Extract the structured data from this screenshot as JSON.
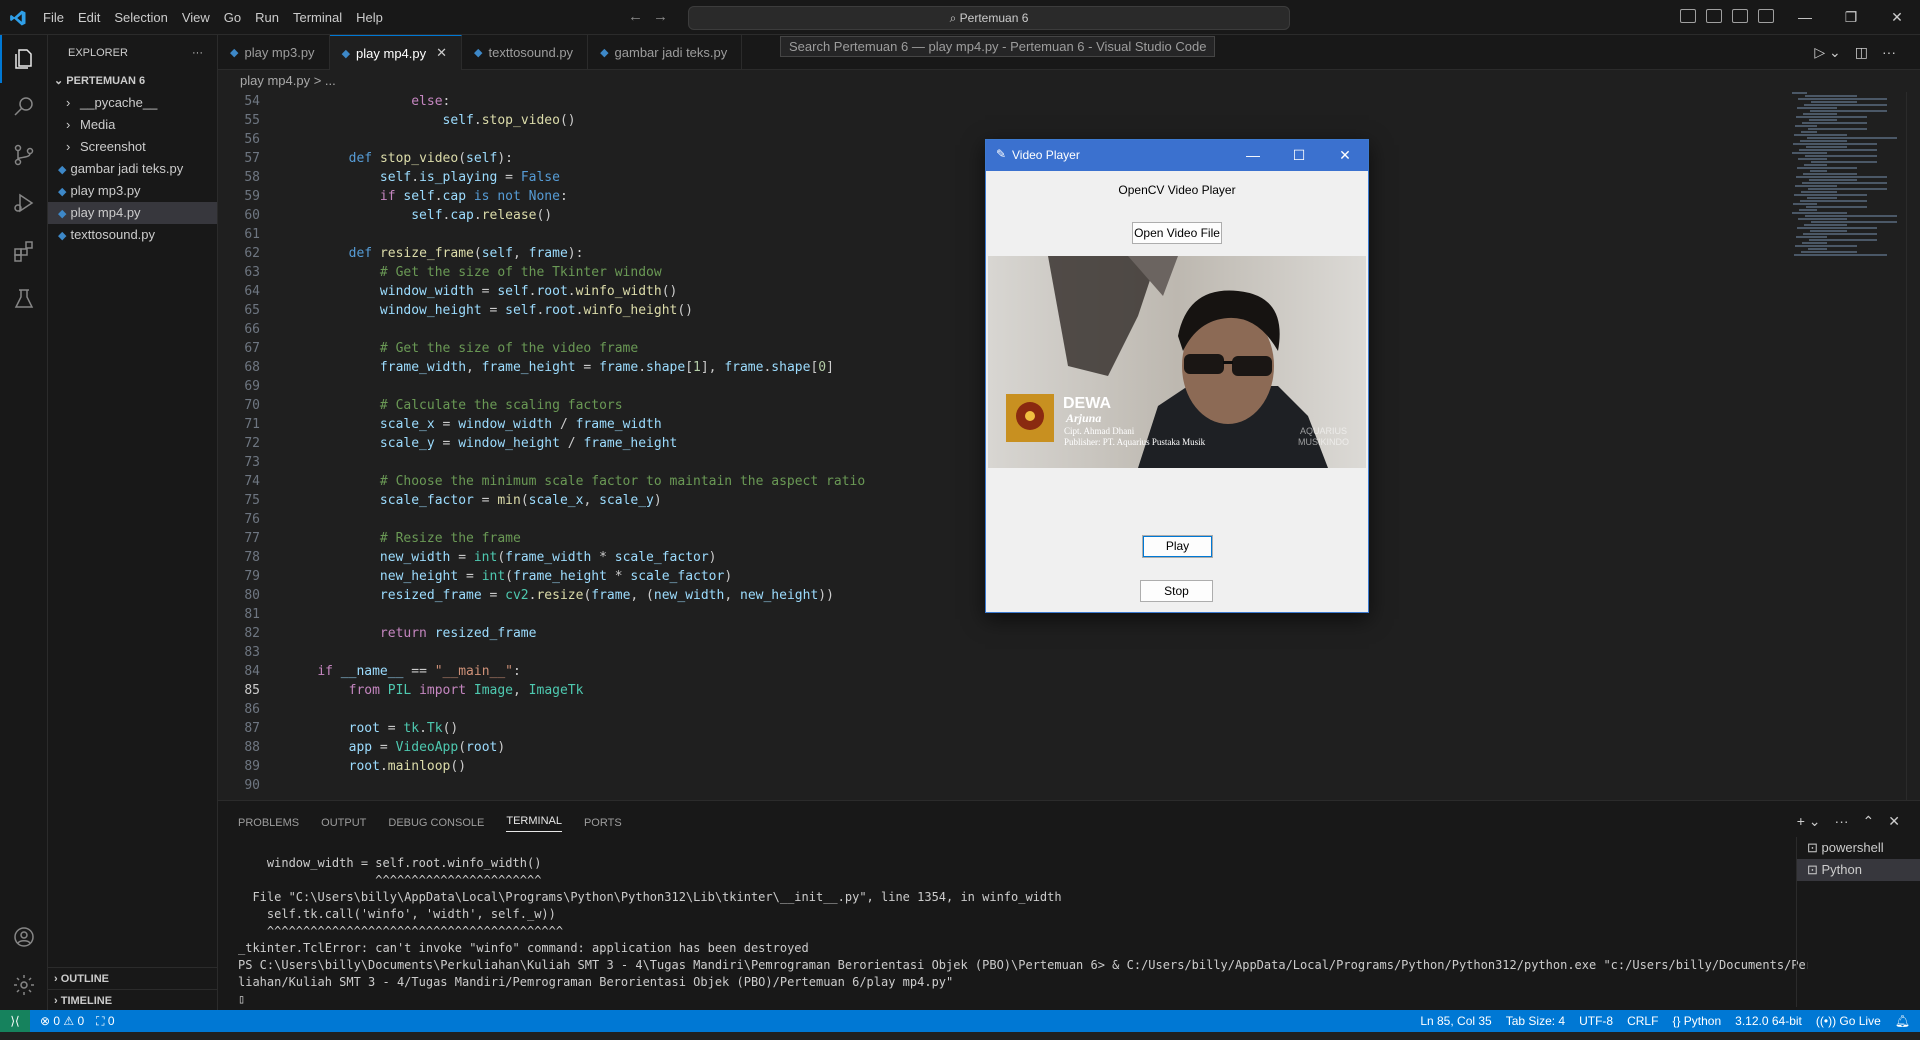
{
  "menu": [
    "File",
    "Edit",
    "Selection",
    "View",
    "Go",
    "Run",
    "Terminal",
    "Help"
  ],
  "command_center": "Pertemuan 6",
  "window_tooltip": "Search Pertemuan 6 — play mp4.py - Pertemuan 6 - Visual Studio Code",
  "explorer": {
    "title": "EXPLORER",
    "more": "···",
    "root": "PERTEMUAN 6",
    "items": [
      {
        "label": "__pycache__",
        "type": "folder"
      },
      {
        "label": "Media",
        "type": "folder"
      },
      {
        "label": "Screenshot",
        "type": "folder"
      },
      {
        "label": "gambar jadi teks.py",
        "type": "file"
      },
      {
        "label": "play mp3.py",
        "type": "file"
      },
      {
        "label": "play mp4.py",
        "type": "file",
        "selected": true
      },
      {
        "label": "texttosound.py",
        "type": "file"
      }
    ],
    "outline": "OUTLINE",
    "timeline": "TIMELINE"
  },
  "tabs": [
    {
      "label": "play mp3.py",
      "active": false
    },
    {
      "label": "play mp4.py",
      "active": true
    },
    {
      "label": "texttosound.py",
      "active": false
    },
    {
      "label": "gambar jadi teks.py",
      "active": false
    }
  ],
  "breadcrumb": "play mp4.py > ...",
  "code_lines": [
    {
      "n": "54",
      "h": "                <span class=\"kw2\">else</span>:"
    },
    {
      "n": "55",
      "h": "                    <span class=\"sf\">self</span>.<span class=\"fn\">stop_video</span>()"
    },
    {
      "n": "56",
      "h": ""
    },
    {
      "n": "57",
      "h": "        <span class=\"kw\">def</span> <span class=\"fn\">stop_video</span>(<span class=\"sf\">self</span>):"
    },
    {
      "n": "58",
      "h": "            <span class=\"sf\">self</span>.<span class=\"sf\">is_playing</span> = <span class=\"kw\">False</span>"
    },
    {
      "n": "59",
      "h": "            <span class=\"kw2\">if</span> <span class=\"sf\">self</span>.<span class=\"sf\">cap</span> <span class=\"kw\">is not</span> <span class=\"kw\">None</span>:"
    },
    {
      "n": "60",
      "h": "                <span class=\"sf\">self</span>.<span class=\"sf\">cap</span>.<span class=\"fn\">release</span>()"
    },
    {
      "n": "61",
      "h": ""
    },
    {
      "n": "62",
      "h": "        <span class=\"kw\">def</span> <span class=\"fn\">resize_frame</span>(<span class=\"sf\">self</span>, <span class=\"sf\">frame</span>):"
    },
    {
      "n": "63",
      "h": "            <span class=\"cm\"># Get the size of the Tkinter window</span>"
    },
    {
      "n": "64",
      "h": "            <span class=\"sf\">window_width</span> = <span class=\"sf\">self</span>.<span class=\"sf\">root</span>.<span class=\"fn\">winfo_width</span>()"
    },
    {
      "n": "65",
      "h": "            <span class=\"sf\">window_height</span> = <span class=\"sf\">self</span>.<span class=\"sf\">root</span>.<span class=\"fn\">winfo_height</span>()"
    },
    {
      "n": "66",
      "h": ""
    },
    {
      "n": "67",
      "h": "            <span class=\"cm\"># Get the size of the video frame</span>"
    },
    {
      "n": "68",
      "h": "            <span class=\"sf\">frame_width</span>, <span class=\"sf\">frame_height</span> = <span class=\"sf\">frame</span>.<span class=\"sf\">shape</span>[<span class=\"nu\">1</span>], <span class=\"sf\">frame</span>.<span class=\"sf\">shape</span>[<span class=\"nu\">0</span>]"
    },
    {
      "n": "69",
      "h": ""
    },
    {
      "n": "70",
      "h": "            <span class=\"cm\"># Calculate the scaling factors</span>"
    },
    {
      "n": "71",
      "h": "            <span class=\"sf\">scale_x</span> = <span class=\"sf\">window_width</span> / <span class=\"sf\">frame_width</span>"
    },
    {
      "n": "72",
      "h": "            <span class=\"sf\">scale_y</span> = <span class=\"sf\">window_height</span> / <span class=\"sf\">frame_height</span>"
    },
    {
      "n": "73",
      "h": ""
    },
    {
      "n": "74",
      "h": "            <span class=\"cm\"># Choose the minimum scale factor to maintain the aspect ratio</span>"
    },
    {
      "n": "75",
      "h": "            <span class=\"sf\">scale_factor</span> = <span class=\"fn\">min</span>(<span class=\"sf\">scale_x</span>, <span class=\"sf\">scale_y</span>)"
    },
    {
      "n": "76",
      "h": ""
    },
    {
      "n": "77",
      "h": "            <span class=\"cm\"># Resize the frame</span>"
    },
    {
      "n": "78",
      "h": "            <span class=\"sf\">new_width</span> = <span class=\"cl\">int</span>(<span class=\"sf\">frame_width</span> * <span class=\"sf\">scale_factor</span>)"
    },
    {
      "n": "79",
      "h": "            <span class=\"sf\">new_height</span> = <span class=\"cl\">int</span>(<span class=\"sf\">frame_height</span> * <span class=\"sf\">scale_factor</span>)"
    },
    {
      "n": "80",
      "h": "            <span class=\"sf\">resized_frame</span> = <span class=\"cl\">cv2</span>.<span class=\"fn\">resize</span>(<span class=\"sf\">frame</span>, (<span class=\"sf\">new_width</span>, <span class=\"sf\">new_height</span>))"
    },
    {
      "n": "81",
      "h": ""
    },
    {
      "n": "82",
      "h": "            <span class=\"kw2\">return</span> <span class=\"sf\">resized_frame</span>"
    },
    {
      "n": "83",
      "h": ""
    },
    {
      "n": "84",
      "h": "    <span class=\"kw2\">if</span> <span class=\"sf\">__name__</span> == <span class=\"st\">\"__main__\"</span>:"
    },
    {
      "n": "85",
      "h": "        <span class=\"kw2\">from</span> <span class=\"cl\">PIL</span> <span class=\"kw2\">import</span> <span class=\"cl\">Image</span>, <span class=\"cl\">ImageTk</span>",
      "cur": true
    },
    {
      "n": "86",
      "h": ""
    },
    {
      "n": "87",
      "h": "        <span class=\"sf\">root</span> = <span class=\"cl\">tk</span>.<span class=\"cl\">Tk</span>()"
    },
    {
      "n": "88",
      "h": "        <span class=\"sf\">app</span> = <span class=\"cl\">VideoApp</span>(<span class=\"sf\">root</span>)"
    },
    {
      "n": "89",
      "h": "        <span class=\"sf\">root</span>.<span class=\"fn\">mainloop</span>()"
    },
    {
      "n": "90",
      "h": ""
    }
  ],
  "panel_tabs": [
    "PROBLEMS",
    "OUTPUT",
    "DEBUG CONSOLE",
    "TERMINAL",
    "PORTS"
  ],
  "terminal_lines": [
    "    window_width = self.root.winfo_width()",
    "                   ^^^^^^^^^^^^^^^^^^^^^^^",
    "  File \"C:\\Users\\billy\\AppData\\Local\\Programs\\Python\\Python312\\Lib\\tkinter\\__init__.py\", line 1354, in winfo_width",
    "    self.tk.call('winfo', 'width', self._w))",
    "    ^^^^^^^^^^^^^^^^^^^^^^^^^^^^^^^^^^^^^^^^^",
    "_tkinter.TclError: can't invoke \"winfo\" command: application has been destroyed",
    "PS C:\\Users\\billy\\Documents\\Perkuliahan\\Kuliah SMT 3 - 4\\Tugas Mandiri\\Pemrograman Berorientasi Objek (PBO)\\Pertemuan 6> & C:/Users/billy/AppData/Local/Programs/Python/Python312/python.exe \"c:/Users/billy/Documents/Perku",
    "liahan/Kuliah SMT 3 - 4/Tugas Mandiri/Pemrograman Berorientasi Objek (PBO)/Pertemuan 6/play mp4.py\"",
    "▯"
  ],
  "terminals": [
    {
      "label": "powershell",
      "selected": false
    },
    {
      "label": "Python",
      "selected": true
    }
  ],
  "status": {
    "errors": "⊗ 0 ⚠ 0",
    "ports": "⛶ 0",
    "cursor": "Ln 85, Col 35",
    "tab": "Tab Size: 4",
    "encoding": "UTF-8",
    "eol": "CRLF",
    "language": "Python",
    "interpreter": "3.12.0 64-bit",
    "golive": "Go Live"
  },
  "tk_window": {
    "title": "Video Player",
    "label": "OpenCV Video Player",
    "open_button": "Open Video File",
    "play_button": "Play",
    "stop_button": "Stop",
    "video_overlay": {
      "band": "DEWA",
      "song": "Arjuna",
      "credit1": "Cipt. Ahmad Dhani",
      "credit2": "Publisher: PT. Aquarius Pustaka Musik",
      "watermark1": "AQUARIUS",
      "watermark2": "MUSIKINDO"
    }
  }
}
